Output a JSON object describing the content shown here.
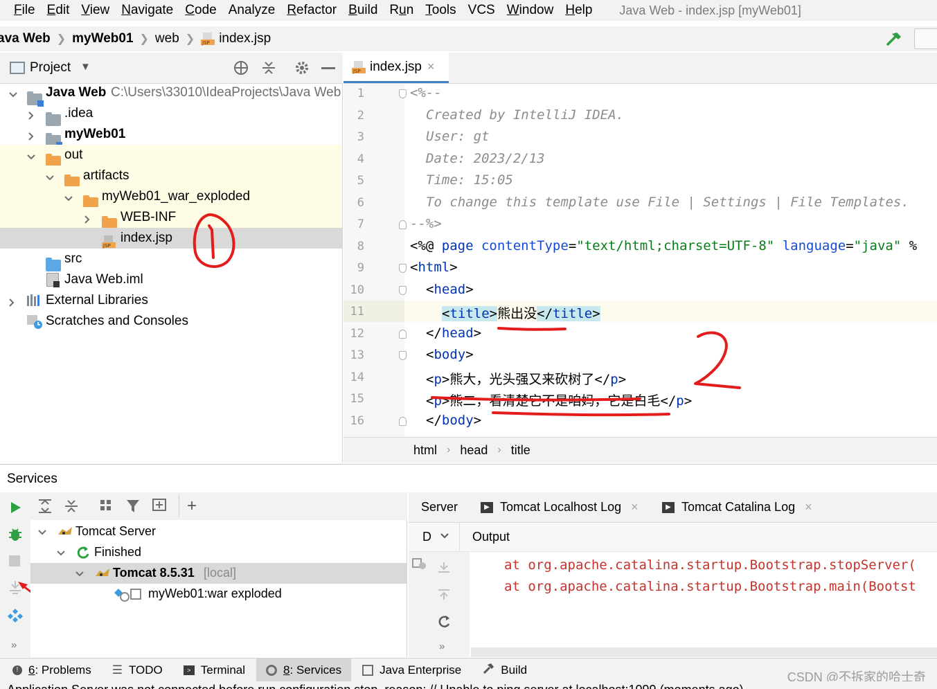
{
  "menu": {
    "items": [
      "File",
      "Edit",
      "View",
      "Navigate",
      "Code",
      "Analyze",
      "Refactor",
      "Build",
      "Run",
      "Tools",
      "VCS",
      "Window",
      "Help"
    ],
    "mnemonics": [
      "F",
      "E",
      "V",
      "N",
      "C",
      "",
      "R",
      "B",
      "u",
      "T",
      "",
      "W",
      "H"
    ],
    "window_title": "Java Web - index.jsp [myWeb01]"
  },
  "navbar": {
    "crumbs": [
      "ava Web",
      "myWeb01",
      "web",
      "index.jsp"
    ]
  },
  "project": {
    "title": "Project",
    "rows": [
      {
        "label": "Java Web",
        "path": "C:\\Users\\33010\\IdeaProjects\\Java Web"
      },
      {
        "label": ".idea"
      },
      {
        "label": "myWeb01"
      },
      {
        "label": "out"
      },
      {
        "label": "artifacts"
      },
      {
        "label": "myWeb01_war_exploded"
      },
      {
        "label": "WEB-INF"
      },
      {
        "label": "index.jsp"
      },
      {
        "label": "src"
      },
      {
        "label": "Java Web.iml"
      },
      {
        "label": "External Libraries"
      },
      {
        "label": "Scratches and Consoles"
      }
    ]
  },
  "editor": {
    "tab": "index.jsp",
    "line_numbers": [
      "1",
      "2",
      "3",
      "4",
      "5",
      "6",
      "7",
      "8",
      "9",
      "10",
      "11",
      "12",
      "13",
      "14",
      "15",
      "16"
    ],
    "lines": {
      "l1": "<%--",
      "l2": "Created by IntelliJ IDEA.",
      "l3": "User: gt",
      "l4": "Date: 2023/2/13",
      "l5": "Time: 15:05",
      "l6": "To change this template use File | Settings | File Templates.",
      "l7": "--%>",
      "l8": {
        "p1": "<%@ ",
        "p2": "page ",
        "p3": "contentType",
        "p4": "=",
        "p5": "\"text/html;charset=UTF-8\"",
        "p6": " ",
        "p7": "language",
        "p8": "=",
        "p9": "\"java\"",
        "p10": " %"
      },
      "l9": {
        "open": "<",
        "tag": "html",
        "close": ">"
      },
      "l10": {
        "open": "<",
        "tag": "head",
        "close": ">"
      },
      "l11": {
        "open": "<",
        "tag": "title",
        "close": ">",
        "text": "熊出没",
        "eopen": "</",
        "etag": "title",
        "eclose": ">"
      },
      "l12": {
        "open": "</",
        "tag": "head",
        "close": ">"
      },
      "l13": {
        "open": "<",
        "tag": "body",
        "close": ">"
      },
      "l14": {
        "open": "<",
        "tag": "p",
        "close": ">",
        "text": "熊大，光头强又来砍树了",
        "eopen": "</",
        "etag": "p",
        "eclose": ">"
      },
      "l15": {
        "open": "<",
        "tag": "p",
        "close": ">",
        "text": "熊二，看清楚它不是咱妈，它是白毛",
        "eopen": "</",
        "etag": "p",
        "eclose": ">"
      },
      "l16": {
        "open": "</",
        "tag": "body",
        "close": ">"
      }
    },
    "breadcrumb": [
      "html",
      "head",
      "title"
    ]
  },
  "services": {
    "title": "Services",
    "tree": [
      {
        "label": "Tomcat Server"
      },
      {
        "label": "Finished"
      },
      {
        "label": "Tomcat 8.5.31",
        "suffix": "[local]"
      },
      {
        "label": "myWeb01:war exploded"
      }
    ],
    "right_tabs": [
      "Server",
      "Tomcat Localhost Log",
      "Tomcat Catalina Log"
    ],
    "output_head_left": "D",
    "output_title": "Output",
    "output_lines": [
      "at org.apache.catalina.startup.Bootstrap.stopServer(",
      "at org.apache.catalina.startup.Bootstrap.main(Bootst"
    ],
    "more": "»"
  },
  "toolwindows": {
    "items": [
      {
        "num": "6",
        "label": ": Problems"
      },
      {
        "num": "",
        "label": "TODO"
      },
      {
        "num": "",
        "label": "Terminal"
      },
      {
        "num": "8",
        "label": ": Services"
      },
      {
        "num": "",
        "label": "Java Enterprise"
      },
      {
        "num": "",
        "label": "Build"
      }
    ]
  },
  "status_text": "Application Server was not connected before run configuration stop, reason: // Unable to ping server at localhost:1099 (moments ago)",
  "watermark": "CSDN @不拆家的哈士奇",
  "colors": {
    "folder_orange": "#f0a34a",
    "folder_gray": "#9aa7b0",
    "folder_blue": "#5aa9e6",
    "annotation_red": "#e31c1c",
    "selected_row": "#d9d9d9",
    "excluded_bg": "#fefce4",
    "run_green": "#2ea043",
    "tag_blue": "#0033b3",
    "string_green": "#067d17",
    "error_red": "#c2342e"
  }
}
